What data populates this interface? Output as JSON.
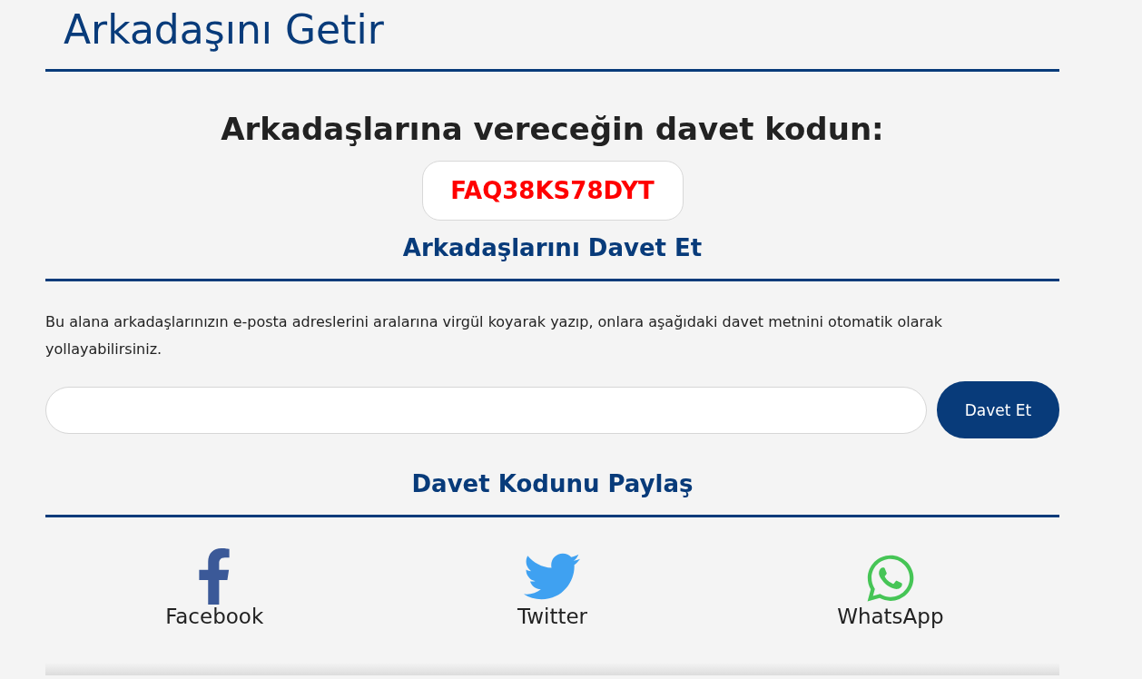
{
  "page_title": "Arkadaşını Getir",
  "code_heading": "Arkadaşlarına vereceğin davet kodun:",
  "invite_code": "FAQ38KS78DYT",
  "invite_section": {
    "title": "Arkadaşlarını Davet Et",
    "description": "Bu alana arkadaşlarınızın e-posta adreslerini aralarına virgül koyarak yazıp, onlara aşağıdaki davet metnini otomatik olarak yollayabilirsiniz.",
    "button": "Davet Et"
  },
  "share_section": {
    "title": "Davet Kodunu Paylaş",
    "items": [
      {
        "kind": "facebook",
        "label": "Facebook"
      },
      {
        "kind": "twitter",
        "label": "Twitter"
      },
      {
        "kind": "whatsapp",
        "label": "WhatsApp"
      }
    ]
  }
}
